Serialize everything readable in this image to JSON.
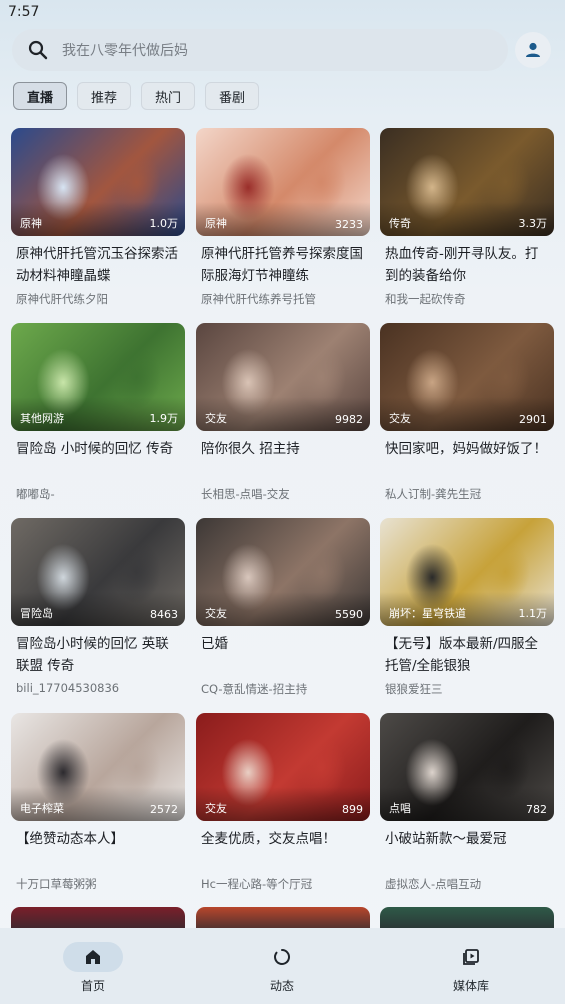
{
  "status_bar": {
    "time": "7:57"
  },
  "search": {
    "placeholder": "我在八零年代做后妈"
  },
  "tabs": [
    {
      "label": "直播",
      "active": true
    },
    {
      "label": "推荐",
      "active": false
    },
    {
      "label": "热门",
      "active": false
    },
    {
      "label": "番剧",
      "active": false
    }
  ],
  "cards": [
    {
      "category": "原神",
      "views": "1.0万",
      "title": "原神代肝托管沉玉谷探索活动材料神瞳晶蝶",
      "owner": "原神代肝代练夕阳",
      "thumb_colors": [
        "#2b4a8c",
        "#d7e4f3",
        "#a2563f"
      ]
    },
    {
      "category": "原神",
      "views": "3233",
      "title": "原神代肝托管养号探索度国际服海灯节神瞳练",
      "owner": "原神代肝代练养号托管",
      "thumb_colors": [
        "#f3d6c9",
        "#9a2e2a",
        "#d4896a"
      ]
    },
    {
      "category": "传奇",
      "views": "3.3万",
      "title": "热血传奇-刚开寻队友。打到的装备给你",
      "owner": "和我一起砍传奇",
      "thumb_colors": [
        "#3a2e22",
        "#d3b58a",
        "#7a5a2d"
      ]
    },
    {
      "category": "其他网游",
      "views": "1.9万",
      "title": "冒险岛 小时候的回忆 传奇",
      "owner": "嘟嘟岛-",
      "thumb_colors": [
        "#6da94c",
        "#c8e5a9",
        "#3e7331"
      ]
    },
    {
      "category": "交友",
      "views": "9982",
      "title": "陪你很久 招主持",
      "owner": "长相思-点唱-交友",
      "thumb_colors": [
        "#5a4640",
        "#d9c3b5",
        "#9d8172"
      ]
    },
    {
      "category": "交友",
      "views": "2901",
      "title": "快回家吧，妈妈做好饭了！",
      "owner": "私人订制-龚先生冠",
      "thumb_colors": [
        "#4a3222",
        "#c8a484",
        "#7e5a3f"
      ]
    },
    {
      "category": "冒险岛",
      "views": "8463",
      "title": "冒险岛小时候的回忆 英联联盟 传奇",
      "owner": "bili_17704530836",
      "thumb_colors": [
        "#6f6a64",
        "#cfd6dc",
        "#3a3a3c"
      ]
    },
    {
      "category": "交友",
      "views": "5590",
      "title": "已婚",
      "owner": "CQ-意乱情迷-招主持",
      "thumb_colors": [
        "#3d3836",
        "#d8c6bc",
        "#8d7466"
      ]
    },
    {
      "category": "崩坏：星穹铁道",
      "views": "1.1万",
      "title": "【无号】版本最新/四服全托管/全能银狼",
      "owner": "银狼爱狂三",
      "thumb_colors": [
        "#e8e2d2",
        "#2a2a2a",
        "#c7a23a"
      ]
    },
    {
      "category": "电子榨菜",
      "views": "2572",
      "title": "【绝赞动态本人】",
      "owner": "十万口草莓粥粥",
      "thumb_colors": [
        "#e9e6e4",
        "#2c2a2e",
        "#b8a69c"
      ]
    },
    {
      "category": "交友",
      "views": "899",
      "title": "全麦优质，交友点唱！",
      "owner": "Hc一程心路-等个厅冠",
      "thumb_colors": [
        "#8a1c1c",
        "#e9cfc4",
        "#c33a32"
      ]
    },
    {
      "category": "点唱",
      "views": "782",
      "title": "小破站新款～最爱冠",
      "owner": "虚拟恋人-点唱互动",
      "thumb_colors": [
        "#4d4a47",
        "#dcd3cc",
        "#1f1d1c"
      ]
    }
  ],
  "peek_colors": [
    "#7a1f2a",
    "#b8462c",
    "#2e5a48"
  ],
  "bottom_nav": [
    {
      "label": "首页",
      "icon": "home-icon",
      "active": true
    },
    {
      "label": "动态",
      "icon": "dynamic-circle-icon",
      "active": false
    },
    {
      "label": "媒体库",
      "icon": "media-library-icon",
      "active": false
    }
  ],
  "colors": {
    "accent": "#1b5a8c",
    "nav_active_pill": "#cfdde9"
  }
}
